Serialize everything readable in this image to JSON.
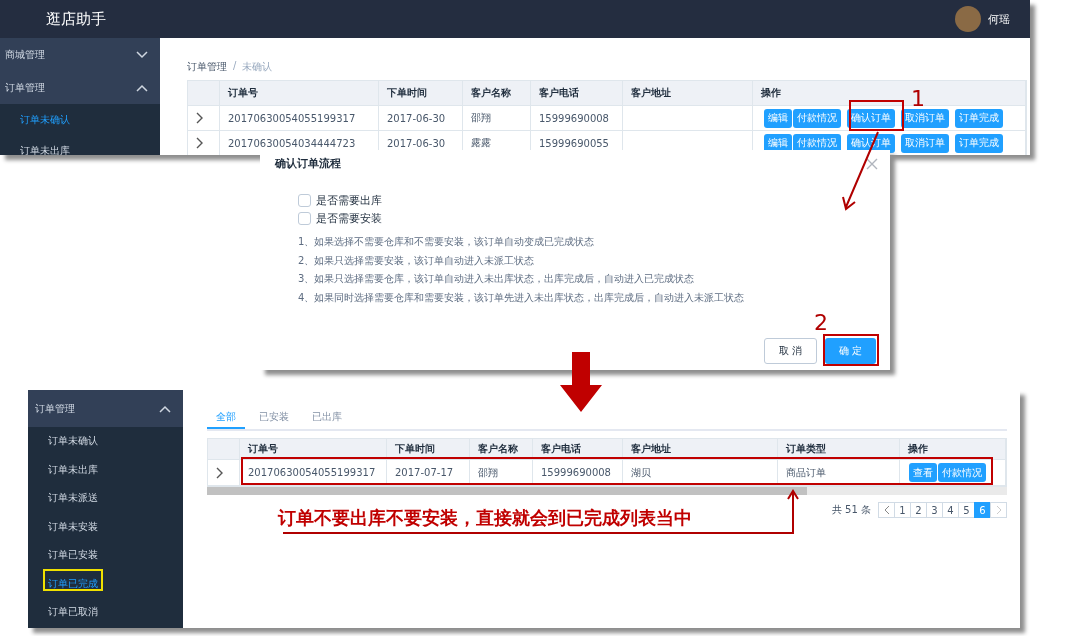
{
  "top_screen": {
    "app_title": "逛店助手",
    "user_name": "何瑶",
    "sidebar": [
      {
        "label": "商城管理",
        "expanded": false
      },
      {
        "label": "订单管理",
        "expanded": true,
        "children": [
          {
            "label": "订单未确认",
            "selected": true
          },
          {
            "label": "订单未出库",
            "selected": false
          }
        ]
      }
    ],
    "breadcrumb": [
      "订单管理",
      "未确认"
    ],
    "breadcrumb_separator": "/",
    "columns": [
      "订单号",
      "下单时间",
      "客户名称",
      "客户电话",
      "客户地址",
      "操作"
    ],
    "rows": [
      {
        "order_no": "20170630054055199317",
        "date": "2017-06-30",
        "customer": "邵翔",
        "phone": "15999690008",
        "actions": [
          "编辑",
          "付款情况",
          "确认订单",
          "取消订单",
          "订单完成"
        ]
      },
      {
        "order_no": "20170630054034444723",
        "date": "2017-06-30",
        "customer": "露露",
        "phone": "15999690055",
        "actions": [
          "编辑",
          "付款情况",
          "确认订单",
          "取消订单",
          "订单完成"
        ]
      }
    ]
  },
  "dialog": {
    "title": "确认订单流程",
    "checkboxes": [
      {
        "label": "是否需要出库",
        "checked": false
      },
      {
        "label": "是否需要安装",
        "checked": false
      }
    ],
    "notes": [
      "1、如果选择不需要仓库和不需要安装，该订单自动变成已完成状态",
      "2、如果只选择需要安装，该订单自动进入未派工状态",
      "3、如果只选择需要仓库，该订单自动进入未出库状态，出库完成后，自动进入已完成状态",
      "4、如果同时选择需要仓库和需要安装，该订单先进入未出库状态，出库完成后，自动进入未派工状态"
    ],
    "cancel_button": "取 消",
    "ok_button": "确 定"
  },
  "bottom_screen": {
    "sidebar_group": {
      "label": "订单管理",
      "expanded": true
    },
    "sidebar_items": [
      {
        "label": "订单未确认",
        "selected": false
      },
      {
        "label": "订单未出库",
        "selected": false
      },
      {
        "label": "订单未派送",
        "selected": false
      },
      {
        "label": "订单未安装",
        "selected": false
      },
      {
        "label": "订单已安装",
        "selected": false
      },
      {
        "label": "订单已完成",
        "selected": true
      },
      {
        "label": "订单已取消",
        "selected": false
      }
    ],
    "tabs": [
      {
        "label": "全部",
        "selected": true
      },
      {
        "label": "已安装",
        "selected": false
      },
      {
        "label": "已出库",
        "selected": false
      }
    ],
    "columns": [
      "订单号",
      "下单时间",
      "客户名称",
      "客户电话",
      "客户地址",
      "订单类型",
      "操作"
    ],
    "rows": [
      {
        "order_no": "20170630054055199317",
        "date": "2017-07-17",
        "customer": "邵翔",
        "phone": "15999690008",
        "address": "湖贝",
        "type": "商品订单",
        "actions": [
          "查看",
          "付款情况"
        ]
      }
    ],
    "total": "共 51 条",
    "pages": [
      {
        "label": "1",
        "selected": false
      },
      {
        "label": "2",
        "selected": false
      },
      {
        "label": "3",
        "selected": false
      },
      {
        "label": "4",
        "selected": false
      },
      {
        "label": "5",
        "selected": false
      },
      {
        "label": "6",
        "selected": true
      }
    ]
  },
  "annotations": {
    "step_1": "1",
    "step_2": "2",
    "caption": "订单不要出库不要安装，直接就会到已完成列表当中"
  }
}
